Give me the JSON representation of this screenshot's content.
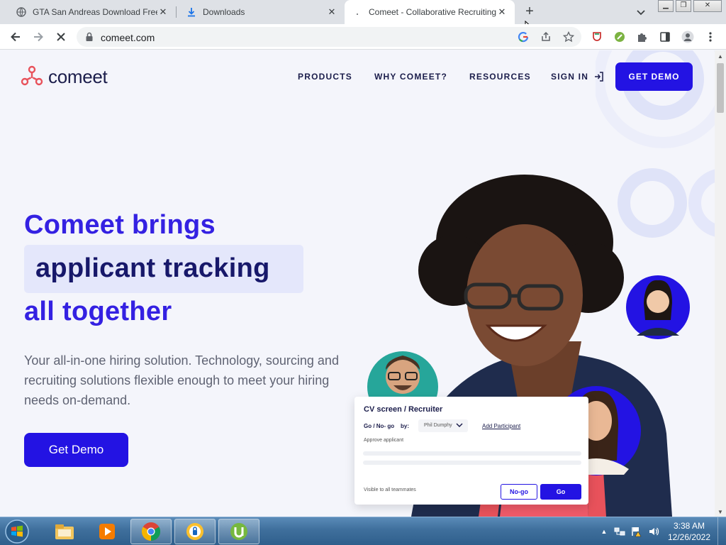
{
  "browser": {
    "tabs": [
      {
        "title": "GTA San Andreas Download Free",
        "icon": "globe-icon"
      },
      {
        "title": "Downloads",
        "icon": "download-icon"
      },
      {
        "title": "Comeet - Collaborative Recruiting",
        "icon": "loading-dot-icon",
        "active": true
      }
    ],
    "url": "comeet.com",
    "window_controls": [
      "minimize",
      "restore",
      "close"
    ]
  },
  "page": {
    "logo_text": "comeet",
    "nav": {
      "products": "PRODUCTS",
      "why": "WHY COMEET?",
      "resources": "RESOURCES",
      "signin": "SIGN IN",
      "demo": "GET DEMO"
    },
    "hero": {
      "line1": "Comeet brings",
      "line2": "applicant tracking",
      "line3": "all together",
      "subtitle": "Your all-in-one hiring solution. Technology, sourcing and recruiting solutions flexible enough to meet your hiring needs on-demand.",
      "cta": "Get Demo"
    },
    "card": {
      "title": "CV screen / Recruiter",
      "go_nogo": "Go / No- go",
      "by": "by:",
      "selected_user": "Phil Dumphy",
      "add_participant": "Add Participant",
      "approve": "Approve applicant",
      "visible": "Visible to all teammates",
      "nogo_btn": "No-go",
      "go_btn": "Go"
    },
    "colors": {
      "accent": "#2313e3",
      "heading": "#3421e2",
      "dark": "#1b1d4b"
    }
  },
  "taskbar": {
    "apps": [
      "windows-explorer-icon",
      "media-player-icon",
      "chrome-icon",
      "vpn-icon",
      "utorrent-icon"
    ],
    "time": "3:38 AM",
    "date": "12/26/2022"
  }
}
